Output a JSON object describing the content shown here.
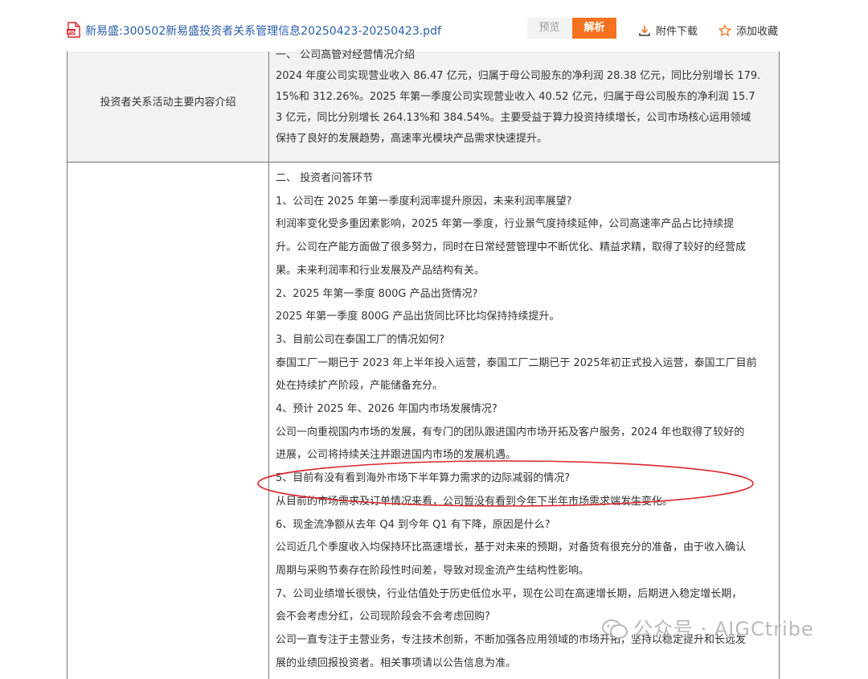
{
  "header": {
    "file_title": "新易盛:300502新易盛投资者关系管理信息20250423-20250423.pdf",
    "preview_label": "预览",
    "parse_label": "解析",
    "download_label": "附件下载",
    "favorite_label": "添加收藏"
  },
  "table": {
    "row1": {
      "label": "投资者关系活动主要内容介绍",
      "lines": [
        "一、 公司高管对经营情况介绍",
        "2024 年度公司实现营业收入 86.47 亿元，归属于母公司股东的净利润 28.38 亿元，同比分别增长 179.",
        "15%和 312.26%。2025 年第一季度公司实现营业收入 40.52 亿元，归属于母公司股东的净利润 15.7",
        "3 亿元，同比分别增长 264.13%和 384.54%。主要受益于算力投资持续增长，公司市场核心运用领域",
        "保持了良好的发展趋势，高速率光模块产品需求快速提升。"
      ]
    },
    "row2": {
      "lines": [
        "二、 投资者问答环节",
        "1、公司在 2025 年第一季度利润率提升原因，未来利润率展望?",
        "利润率变化受多重因素影响，2025 年第一季度，行业景气度持续延伸，公司高速率产品占比持续提",
        "升。公司在产能方面做了很多努力，同时在日常经营管理中不断优化、精益求精，取得了较好的经营成",
        "果。未来利润率和行业发展及产品结构有关。",
        "2、2025 年第一季度 800G 产品出货情况?",
        "2025 年第一季度 800G 产品出货同比环比均保持持续提升。",
        "3、目前公司在泰国工厂的情况如何?",
        "泰国工厂一期已于 2023 年上半年投入运营，泰国工厂二期已于 2025年初正式投入运营，泰国工厂目前",
        "处在持续扩产阶段，产能储备充分。",
        "4、预计 2025 年、2026 年国内市场发展情况?",
        "公司一向重视国内市场的发展，有专门的团队跟进国内市场开拓及客户服务，2024 年也取得了较好的",
        "进展，公司将持续关注并跟进国内市场的发展机遇。",
        "5、目前有没有看到海外市场下半年算力需求的边际减弱的情况?",
        "从目前的市场需求及订单情况来看，公司暂没有看到今年下半年市场需求端发生变化。",
        "6、现金流净额从去年 Q4 到今年 Q1 有下降，原因是什么?",
        "公司近几个季度收入均保持环比高速增长，基于对未来的预期，对备货有很充分的准备，由于收入确认",
        "周期与采购节奏存在阶段性时间差，导致对现金流产生结构性影响。",
        "7、公司业绩增长很快，行业估值处于历史低位水平，现在公司在高速增长期，后期进入稳定增长期，",
        "会不会考虑分红，公司现阶段会不会考虑回购?",
        "公司一直专注于主营业务，专注技术创新，不断加强各应用领域的市场开拓，坚持以稳定提升和长远发",
        "展的业绩回报投资者。相关事项请以公告信息为准。"
      ]
    }
  },
  "watermark": "公众号 · AIGCtribe",
  "colors": {
    "title_blue": "#2a5ea8",
    "parse_orange": "#f4711f",
    "annotation_red": "#d9272e",
    "row_highlight": "#f2f2f2"
  },
  "icons": [
    "pdf-file-icon",
    "download-icon",
    "star-icon",
    "wechat-icon"
  ]
}
